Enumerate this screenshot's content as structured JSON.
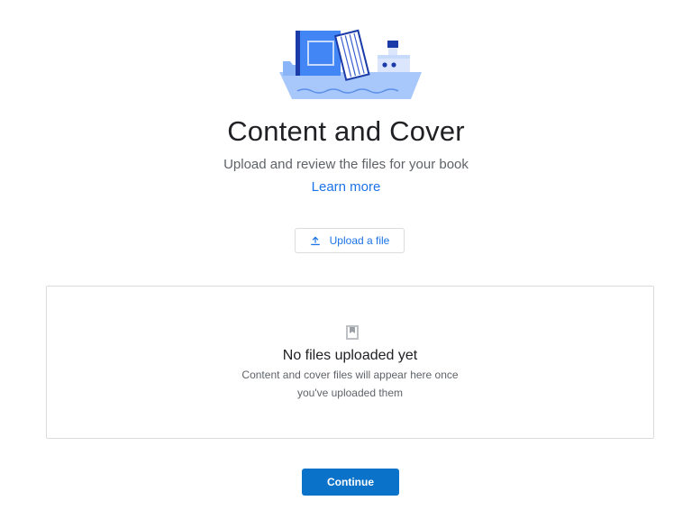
{
  "header": {
    "illustration": "books-on-boat-illustration",
    "title": "Content and Cover",
    "subtitle": "Upload and review the files for your book",
    "learn_more": "Learn more"
  },
  "upload": {
    "label": "Upload a file",
    "icon": "upload-icon"
  },
  "files_panel": {
    "icon": "bookmark-icon",
    "empty_title": "No files uploaded yet",
    "empty_desc_line1": "Content and cover files will appear here once",
    "empty_desc_line2": "you've uploaded them"
  },
  "footer": {
    "continue_label": "Continue"
  },
  "colors": {
    "accent": "#1a73e8",
    "primary_button": "#0b72c9",
    "text": "#202124",
    "muted_text": "#5f6368",
    "border": "#dadce0"
  }
}
